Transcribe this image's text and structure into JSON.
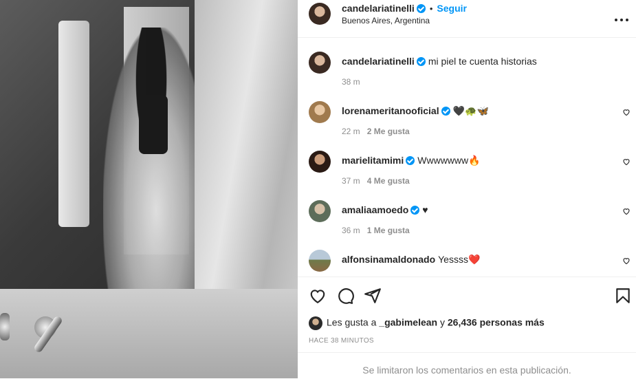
{
  "post": {
    "author": "candelariatinelli",
    "follow_label": "Seguir",
    "separator": "•",
    "location": "Buenos Aires, Argentina",
    "more_icon": "more-horizontal-icon"
  },
  "caption": {
    "username": "candelariatinelli",
    "text": "mi piel te cuenta historias",
    "time": "38 m"
  },
  "comments": [
    {
      "username": "lorenameritanooficial",
      "text": "🖤🐢🦋",
      "time": "22 m",
      "likes": "2 Me gusta"
    },
    {
      "username": "marielitamimi",
      "text": "Wwwwwww🔥",
      "time": "37 m",
      "likes": "4 Me gusta"
    },
    {
      "username": "amaliaamoedo",
      "text": "♥",
      "time": "36 m",
      "likes": "1 Me gusta"
    },
    {
      "username": "alfonsinamaldonado",
      "text": "Yessss❤️",
      "time": "",
      "likes": ""
    }
  ],
  "likes": {
    "prefix": "Les gusta a",
    "user": "_gabimelean",
    "conj": "y",
    "count": "26,436 personas más"
  },
  "time_ago": "HACE 38 MINUTOS",
  "footer": "Se limitaron los comentarios en esta publicación.",
  "colors": {
    "accent": "#0095f6",
    "muted": "#8e8e8e",
    "text": "#262626"
  }
}
